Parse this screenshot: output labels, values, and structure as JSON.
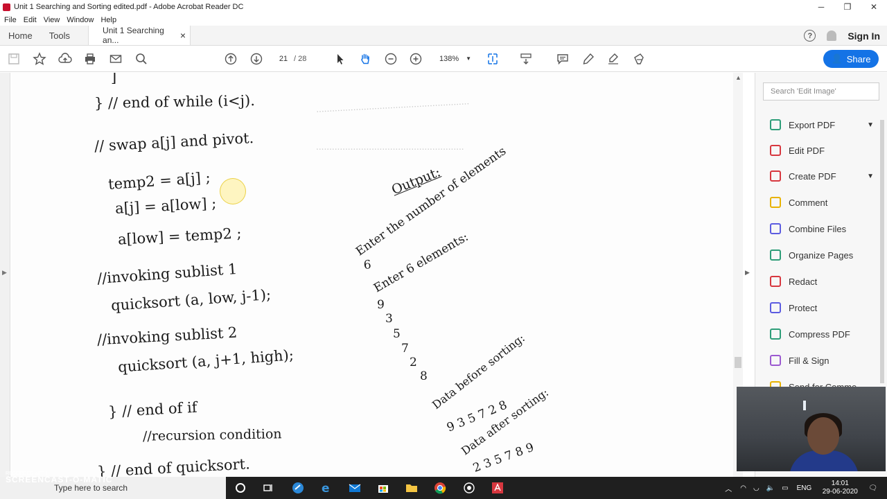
{
  "window": {
    "title": "Unit 1 Searching and Sorting edited.pdf - Adobe Acrobat Reader DC",
    "minimize": "─",
    "maximize": "❐",
    "close": "✕"
  },
  "menu": [
    "File",
    "Edit",
    "View",
    "Window",
    "Help"
  ],
  "tabs": {
    "home": "Home",
    "tools": "Tools",
    "document": "Unit 1 Searching an...",
    "close": "×",
    "help": "?",
    "sign_in": "Sign In"
  },
  "toolbar": {
    "page_current": "21",
    "page_total": "/ 28",
    "zoom": "138%",
    "share": "Share"
  },
  "document": {
    "lines": [
      "]",
      "} // end of while (i<j).",
      "// swap a[j] and pivot.",
      "temp2 = a[j] ;",
      "a[j] = a[low] ;",
      "a[low] = temp2 ;",
      "//invoking sublist 1",
      "quicksort (a, low, j-1);",
      "//invoking sublist 2",
      "quicksort (a, j+1, high);",
      "} // end of if",
      "//recursion condition",
      "} // end of quicksort."
    ],
    "output": {
      "heading": "Output:",
      "prompt1": "Enter the number of elements",
      "count": "6",
      "prompt2": "Enter 6 elements:",
      "inputs": [
        "9",
        "3",
        "5",
        "7",
        "2",
        "8"
      ],
      "before_label": "Data before sorting:",
      "before_values": "9 3 5 7 2 8",
      "after_label": "Data after sorting:",
      "after_values": "2 3 5 7 8 9"
    }
  },
  "panel": {
    "search_placeholder": "Search 'Edit Image'",
    "tools": [
      {
        "label": "Export PDF",
        "color": "#2d9d78",
        "chevron": true
      },
      {
        "label": "Edit PDF",
        "color": "#d7373f",
        "chevron": false
      },
      {
        "label": "Create PDF",
        "color": "#d7373f",
        "chevron": true
      },
      {
        "label": "Comment",
        "color": "#e8b200",
        "chevron": false
      },
      {
        "label": "Combine Files",
        "color": "#5c5ce0",
        "chevron": false
      },
      {
        "label": "Organize Pages",
        "color": "#2d9d78",
        "chevron": false
      },
      {
        "label": "Redact",
        "color": "#d7373f",
        "chevron": false
      },
      {
        "label": "Protect",
        "color": "#5c5ce0",
        "chevron": false
      },
      {
        "label": "Compress PDF",
        "color": "#2d9d78",
        "chevron": false
      },
      {
        "label": "Fill & Sign",
        "color": "#9b59d0",
        "chevron": false
      },
      {
        "label": "Send for Comme...",
        "color": "#e8b200",
        "chevron": false
      }
    ]
  },
  "taskbar": {
    "search": "Type here to search",
    "language": "ENG",
    "time": "14:01",
    "date": "29-06-2020"
  },
  "watermark": {
    "line1": "RECORDED WITH",
    "line2": "SCREENCAST-O-MATIC"
  },
  "colors": {
    "accent": "#1473e6",
    "taskbar": "#1f1f1f"
  }
}
